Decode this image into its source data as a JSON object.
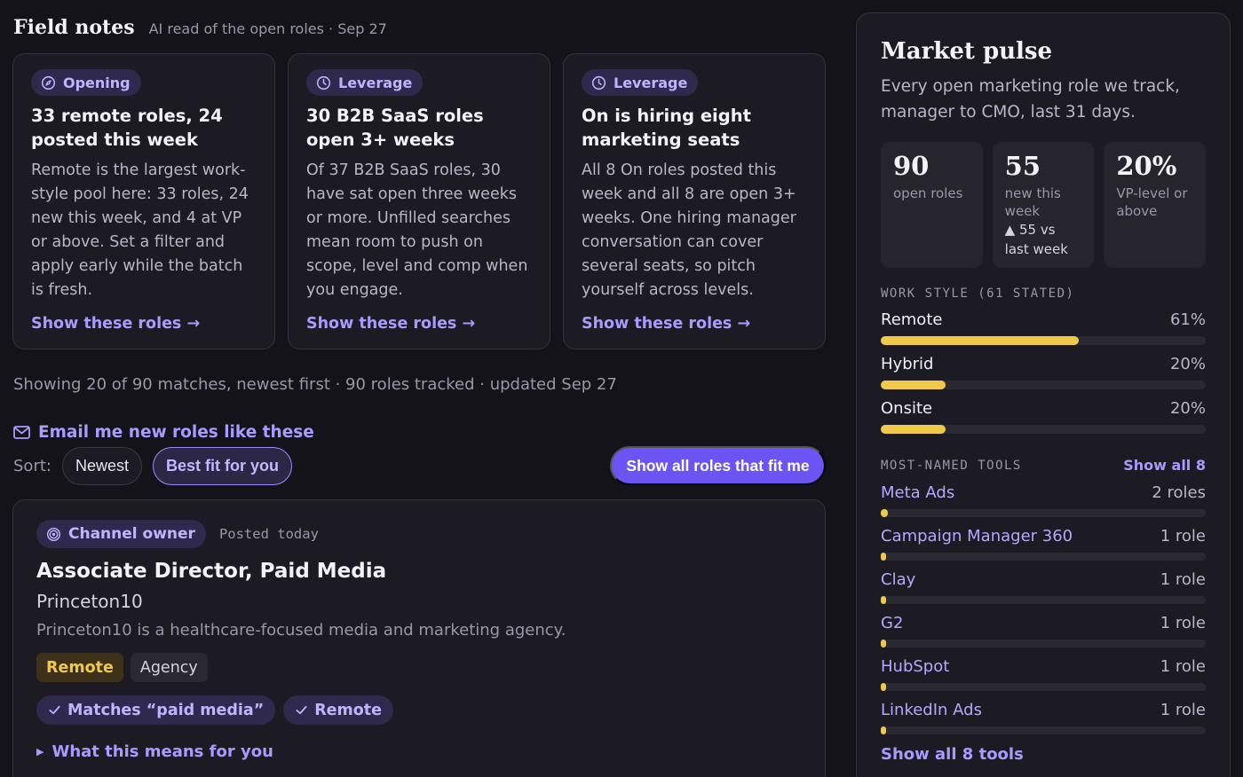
{
  "header": {
    "title": "Field notes",
    "subtitle": "AI read of the open roles · Sep 27"
  },
  "insights": [
    {
      "pill": "Opening",
      "icon": "compass-icon",
      "title": "33 remote roles, 24 posted this week",
      "body": "Remote is the largest work-style pool here: 33 roles, 24 new this week, and 4 at VP or above. Set a filter and apply early while the batch is fresh.",
      "link": "Show these roles →"
    },
    {
      "pill": "Leverage",
      "icon": "clock-icon",
      "title": "30 B2B SaaS roles open 3+ weeks",
      "body": "Of 37 B2B SaaS roles, 30 have sat open three weeks or more. Unfilled searches mean room to push on scope, level and comp when you engage.",
      "link": "Show these roles →"
    },
    {
      "pill": "Leverage",
      "icon": "clock-icon",
      "title": "On is hiring eight marketing seats",
      "body": "All 8 On roles posted this week and all 8 are open 3+ weeks. One hiring manager conversation can cover several seats, so pitch yourself across levels.",
      "link": "Show these roles →"
    }
  ],
  "results": {
    "showing": "Showing 20 of 90 matches, newest first · 90 roles tracked · updated Sep 27",
    "email_link": "Email me new roles like these",
    "sort_label": "Sort:",
    "sort_newest": "Newest",
    "sort_best": "Best fit for you",
    "cta": "Show all roles that fit me"
  },
  "job": {
    "badge": "Channel owner",
    "posted": "Posted today",
    "title": "Associate Director, Paid Media",
    "company": "Princeton10",
    "description": "Princeton10 is a healthcare-focused media and marketing agency.",
    "tags": [
      "Remote",
      "Agency"
    ],
    "matches": [
      "Matches “paid media”",
      "Remote"
    ],
    "expand": "What this means for you"
  },
  "market": {
    "title": "Market pulse",
    "subtitle": "Every open marketing role we track, manager to CMO, last 31 days.",
    "stats": [
      {
        "value": "90",
        "label": "open roles",
        "delta": ""
      },
      {
        "value": "55",
        "label": "new this week",
        "delta": "▲ 55 vs last week"
      },
      {
        "value": "20%",
        "label": "VP-level or above",
        "delta": ""
      }
    ],
    "work_style_label": "WORK STYLE (61 STATED)",
    "work_styles": [
      {
        "name": "Remote",
        "pct": "61%",
        "value": 0.61
      },
      {
        "name": "Hybrid",
        "pct": "20%",
        "value": 0.2
      },
      {
        "name": "Onsite",
        "pct": "20%",
        "value": 0.2
      }
    ],
    "tools_label": "MOST-NAMED TOOLS",
    "tools_link": "Show all 8",
    "tools": [
      {
        "name": "Meta Ads",
        "count": "2 roles",
        "value": 2
      },
      {
        "name": "Campaign Manager 360",
        "count": "1 role",
        "value": 1
      },
      {
        "name": "Clay",
        "count": "1 role",
        "value": 1
      },
      {
        "name": "G2",
        "count": "1 role",
        "value": 1
      },
      {
        "name": "HubSpot",
        "count": "1 role",
        "value": 1
      },
      {
        "name": "LinkedIn Ads",
        "count": "1 role",
        "value": 1
      }
    ],
    "footer_link": "Show all 8 tools"
  },
  "colors": {
    "accent": "#6b54f4",
    "link": "#a89bff",
    "bar": "#f0c94a",
    "background": "#141319"
  }
}
